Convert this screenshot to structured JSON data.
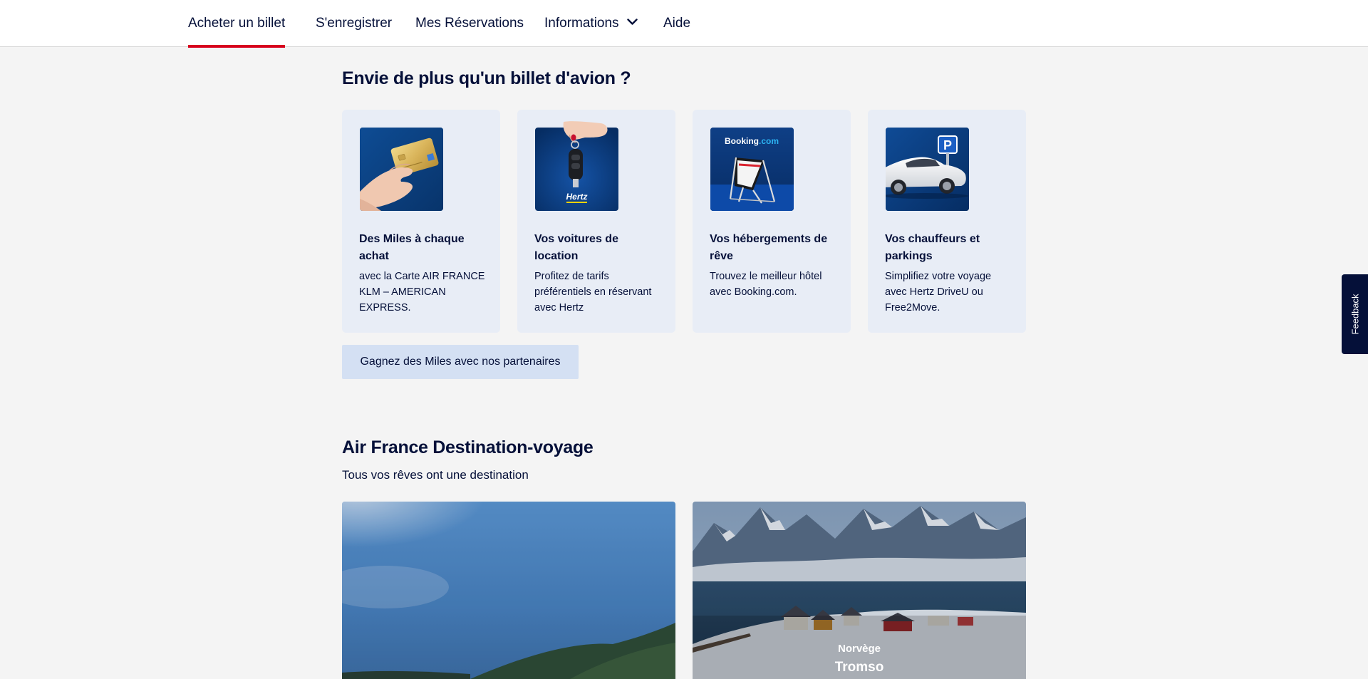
{
  "nav": {
    "items": [
      {
        "label": "Acheter un billet",
        "active": true
      },
      {
        "label": "S'enregistrer"
      },
      {
        "label": "Mes Réservations"
      },
      {
        "label": "Informations"
      },
      {
        "label": "Aide"
      }
    ]
  },
  "partners": {
    "heading": "Envie de plus qu'un billet d'avion ?",
    "cards": [
      {
        "title": "Des Miles à chaque achat",
        "desc": "avec la Carte AIR FRANCE KLM – AMERICAN EXPRESS.",
        "icon": "credit-card-image"
      },
      {
        "title": "Vos voitures de location",
        "desc": "Profitez de tarifs préférentiels en réservant avec Hertz",
        "icon": "car-key-image",
        "brand": "Hertz"
      },
      {
        "title": "Vos hébergements de rêve",
        "desc": "Trouvez le meilleur hôtel avec Booking.com.",
        "icon": "beach-chair-image",
        "brand_main": "Booking",
        "brand_suffix": ".com"
      },
      {
        "title": "Vos chauffeurs et parkings",
        "desc": "Simplifiez votre voyage avec Hertz DriveU ou Free2Move.",
        "icon": "car-parking-image",
        "parking_letter": "P"
      }
    ],
    "button_label": "Gagnez des Miles avec nos partenaires"
  },
  "destinations": {
    "heading": "Air France Destination-voyage",
    "subheading": "Tous vos rêves ont une destination",
    "tiles": [
      {
        "country": "",
        "city": ""
      },
      {
        "country": "Norvège",
        "city": "Tromso"
      }
    ]
  },
  "feedback_label": "Feedback",
  "colors": {
    "navy": "#051039",
    "accent_red": "#d7001d",
    "card_bg": "#e8edf6",
    "button_bg": "#d4e0f3",
    "page_bg": "#f4f4f4"
  }
}
